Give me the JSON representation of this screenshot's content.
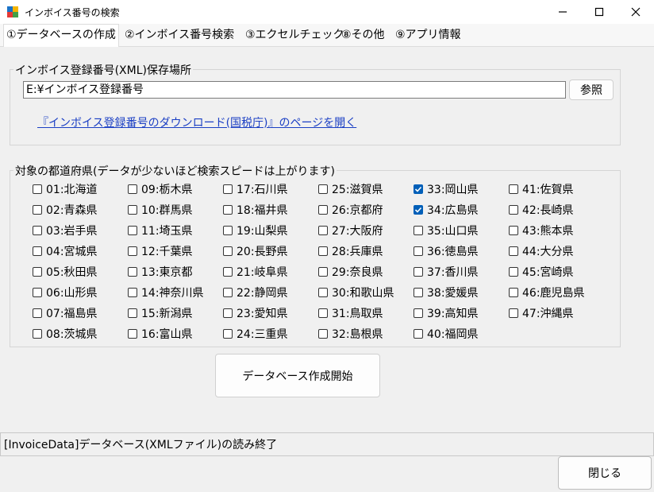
{
  "window": {
    "title": "インボイス番号の検索"
  },
  "tabs": [
    {
      "label": "①データベースの作成",
      "active": true
    },
    {
      "label": "②インボイス番号検索"
    },
    {
      "label": "③エクセルチェック"
    },
    {
      "label": "⑧その他"
    },
    {
      "label": "⑨アプリ情報"
    }
  ],
  "location_group": {
    "title": "インボイス登録番号(XML)保存場所",
    "path_value": "E:¥インボイス登録番号",
    "browse_label": "参照",
    "download_link": "『インボイス登録番号のダウンロード(国税庁)』のページを開く"
  },
  "prefecture_group": {
    "title": "対象の都道府県(データが少ないほど検索スピードは上がります)",
    "items": [
      {
        "label": "01:北海道",
        "checked": false
      },
      {
        "label": "02:青森県",
        "checked": false
      },
      {
        "label": "03:岩手県",
        "checked": false
      },
      {
        "label": "04:宮城県",
        "checked": false
      },
      {
        "label": "05:秋田県",
        "checked": false
      },
      {
        "label": "06:山形県",
        "checked": false
      },
      {
        "label": "07:福島県",
        "checked": false
      },
      {
        "label": "08:茨城県",
        "checked": false
      },
      {
        "label": "09:栃木県",
        "checked": false
      },
      {
        "label": "10:群馬県",
        "checked": false
      },
      {
        "label": "11:埼玉県",
        "checked": false
      },
      {
        "label": "12:千葉県",
        "checked": false
      },
      {
        "label": "13:東京都",
        "checked": false
      },
      {
        "label": "14:神奈川県",
        "checked": false
      },
      {
        "label": "15:新潟県",
        "checked": false
      },
      {
        "label": "16:富山県",
        "checked": false
      },
      {
        "label": "17:石川県",
        "checked": false
      },
      {
        "label": "18:福井県",
        "checked": false
      },
      {
        "label": "19:山梨県",
        "checked": false
      },
      {
        "label": "20:長野県",
        "checked": false
      },
      {
        "label": "21:岐阜県",
        "checked": false
      },
      {
        "label": "22:静岡県",
        "checked": false
      },
      {
        "label": "23:愛知県",
        "checked": false
      },
      {
        "label": "24:三重県",
        "checked": false
      },
      {
        "label": "25:滋賀県",
        "checked": false
      },
      {
        "label": "26:京都府",
        "checked": false
      },
      {
        "label": "27:大阪府",
        "checked": false
      },
      {
        "label": "28:兵庫県",
        "checked": false
      },
      {
        "label": "29:奈良県",
        "checked": false
      },
      {
        "label": "30:和歌山県",
        "checked": false
      },
      {
        "label": "31:鳥取県",
        "checked": false
      },
      {
        "label": "32:島根県",
        "checked": false
      },
      {
        "label": "33:岡山県",
        "checked": true
      },
      {
        "label": "34:広島県",
        "checked": true
      },
      {
        "label": "35:山口県",
        "checked": false
      },
      {
        "label": "36:徳島県",
        "checked": false
      },
      {
        "label": "37:香川県",
        "checked": false
      },
      {
        "label": "38:愛媛県",
        "checked": false
      },
      {
        "label": "39:高知県",
        "checked": false
      },
      {
        "label": "40:福岡県",
        "checked": false
      },
      {
        "label": "41:佐賀県",
        "checked": false
      },
      {
        "label": "42:長崎県",
        "checked": false
      },
      {
        "label": "43:熊本県",
        "checked": false
      },
      {
        "label": "44:大分県",
        "checked": false
      },
      {
        "label": "45:宮崎県",
        "checked": false
      },
      {
        "label": "46:鹿児島県",
        "checked": false
      },
      {
        "label": "47:沖縄県",
        "checked": false
      }
    ]
  },
  "create_button_label": "データベース作成開始",
  "status_text": "[InvoiceData]データベース(XMLファイル)の読み終了",
  "close_button_label": "閉じる",
  "colors": {
    "accent": "#005fb8",
    "link": "#1b3fc4"
  }
}
